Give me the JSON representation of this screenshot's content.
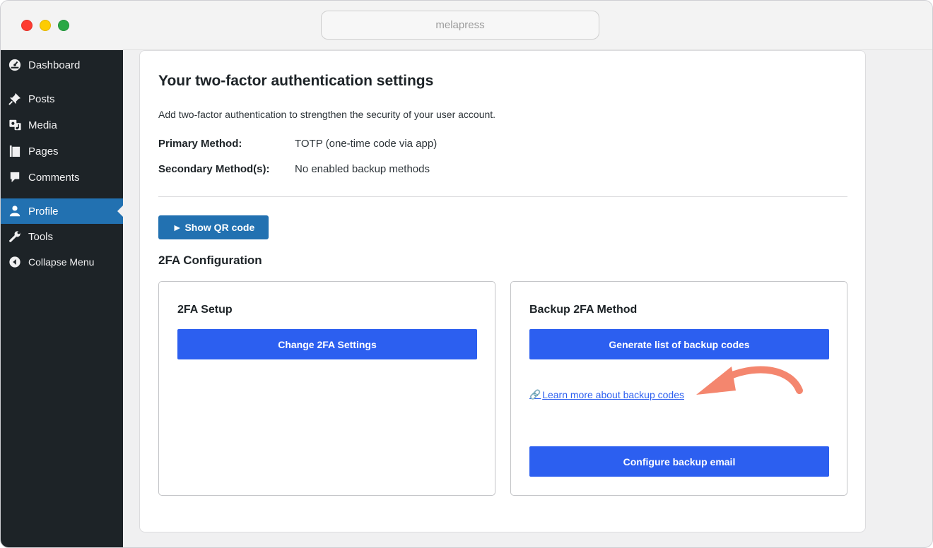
{
  "browser": {
    "url": "melapress"
  },
  "sidebar": {
    "items": [
      {
        "label": "Dashboard",
        "icon": "dashboard-icon"
      },
      {
        "label": "Posts",
        "icon": "pin-icon"
      },
      {
        "label": "Media",
        "icon": "media-icon"
      },
      {
        "label": "Pages",
        "icon": "pages-icon"
      },
      {
        "label": "Comments",
        "icon": "comment-icon"
      },
      {
        "label": "Profile",
        "icon": "user-icon",
        "active": true
      },
      {
        "label": "Tools",
        "icon": "wrench-icon"
      },
      {
        "label": "Collapse Menu",
        "icon": "collapse-icon"
      }
    ]
  },
  "main": {
    "title": "Your two-factor authentication settings",
    "description": "Add two-factor authentication to strengthen the security of your user account.",
    "primary_label": "Primary Method:",
    "primary_value": "TOTP (one-time code via app)",
    "secondary_label": "Secondary Method(s):",
    "secondary_value": "No enabled backup methods",
    "qr_button": "► Show QR code",
    "config_title": "2FA Configuration",
    "setup_card": {
      "title": "2FA Setup",
      "button": "Change 2FA Settings"
    },
    "backup_card": {
      "title": "Backup 2FA Method",
      "generate_button": "Generate list of backup codes",
      "learn_link": "Learn more about backup codes",
      "email_button": "Configure backup email"
    }
  },
  "colors": {
    "sidebar_bg": "#1d2327",
    "active": "#2271b1",
    "primary_button": "#2c5ff0",
    "annotation_arrow": "#f4866e"
  }
}
